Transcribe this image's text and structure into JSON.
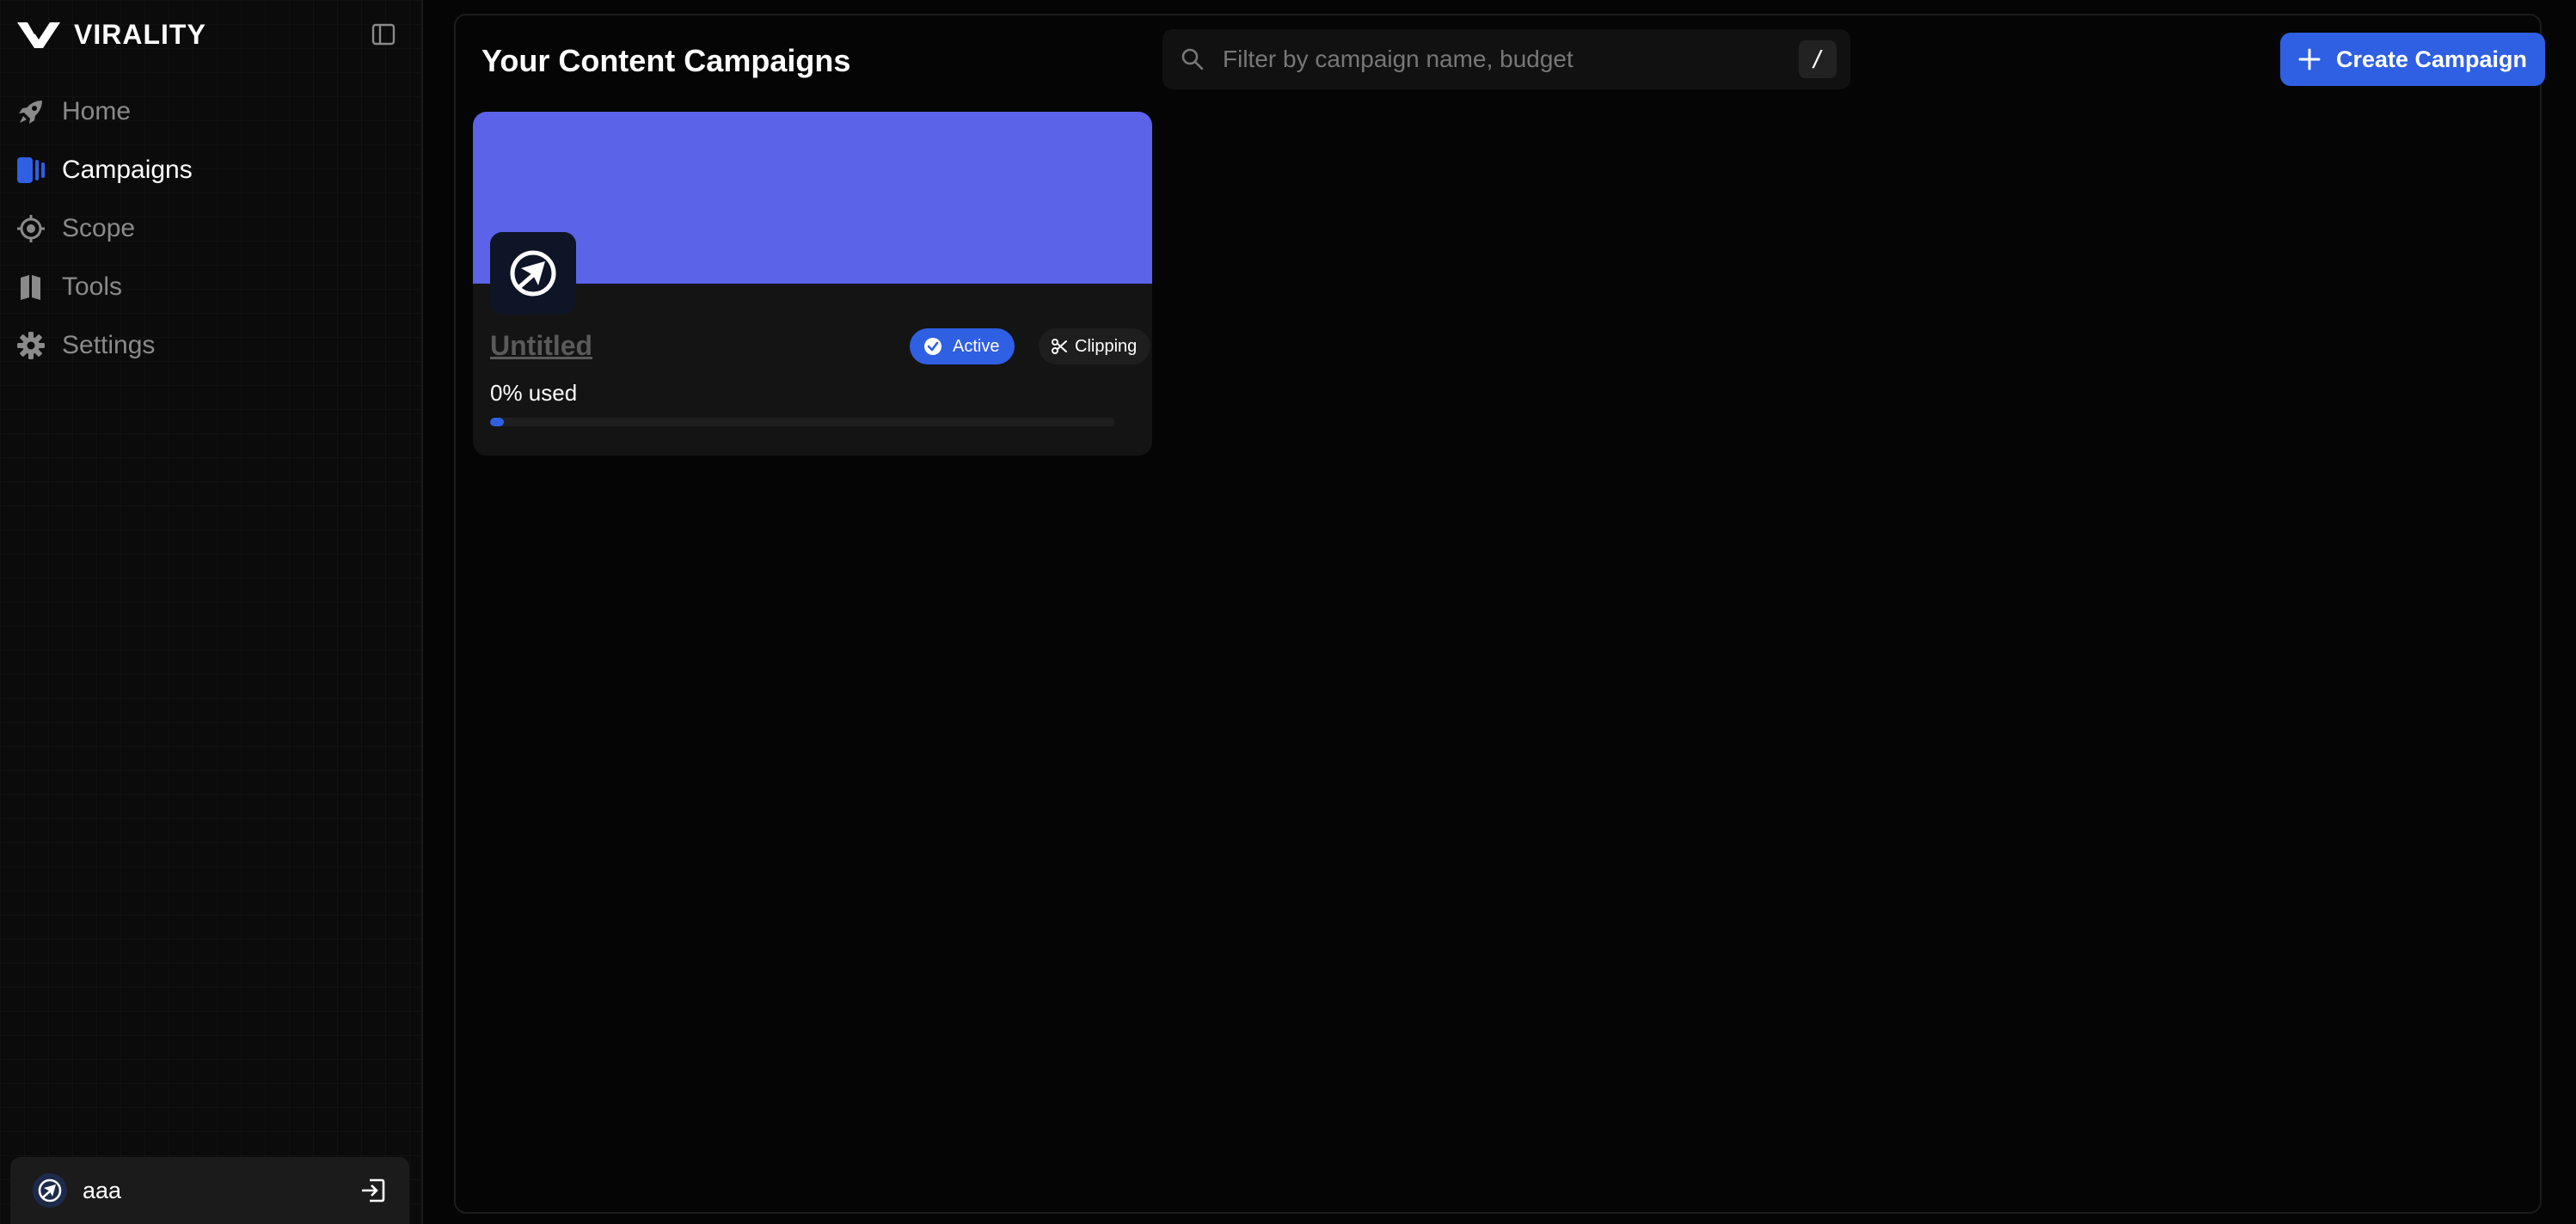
{
  "brand": {
    "name": "VIRALITY",
    "logo_icon": "virality-v-logo-icon"
  },
  "sidebar": {
    "collapse_icon": "sidebar-toggle-icon",
    "items": [
      {
        "label": "Home",
        "icon": "rocket-icon",
        "active": false
      },
      {
        "label": "Campaigns",
        "icon": "campaigns-icon",
        "active": true
      },
      {
        "label": "Scope",
        "icon": "crosshair-icon",
        "active": false
      },
      {
        "label": "Tools",
        "icon": "book-icon",
        "active": false
      },
      {
        "label": "Settings",
        "icon": "gear-icon",
        "active": false
      }
    ],
    "user": {
      "name": "aaa",
      "avatar_icon": "airplane-avatar-icon",
      "logout_icon": "logout-icon"
    }
  },
  "main": {
    "title": "Your Content Campaigns",
    "search": {
      "placeholder": "Filter by campaign name, budget",
      "value": "",
      "shortcut": "/"
    },
    "create_button_label": "Create Campaign",
    "campaigns": [
      {
        "title": "Untitled",
        "status": "Active",
        "type": "Clipping",
        "usage_label": "0% used",
        "usage_fraction": 0.0,
        "banner_color": "#5b63e8",
        "logo_icon": "airplane-logo-icon"
      }
    ]
  },
  "colors": {
    "accent": "#2f5fe3",
    "background": "#050505",
    "sidebar_bg": "#0b0b0b",
    "card_bg": "#141414",
    "muted_text": "#8a8a8a"
  }
}
